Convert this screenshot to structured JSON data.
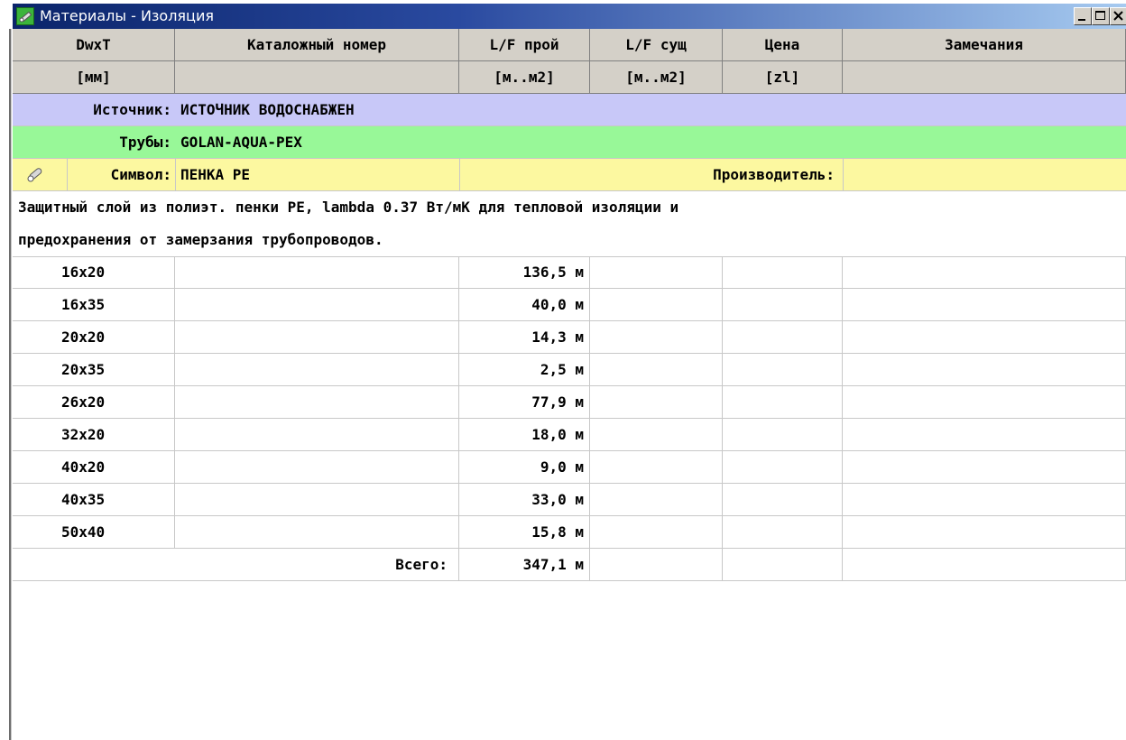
{
  "window": {
    "title": "Материалы - Изоляция",
    "buttons": {
      "minimize": "_",
      "maximize": "□",
      "close": "X"
    }
  },
  "header": {
    "columns": [
      "DwxT",
      "Каталожный номер",
      "L/F прой",
      "L/F сущ",
      "Цена",
      "Замечания"
    ],
    "units": [
      "[мм]",
      "",
      "[м..м2]",
      "[м..м2]",
      "[zl]",
      ""
    ]
  },
  "source": {
    "label": "Источник:",
    "value": "ИСТОЧНИК ВОДОСНАБЖЕН",
    "color": "#c8c8f8"
  },
  "pipes": {
    "label": "Трубы:",
    "value": "GOLAN-AQUA-PEX",
    "color": "#98f898"
  },
  "symbol": {
    "icon": "insulation-tube-icon",
    "label": "Символ:",
    "value": "ПЕНКА PE",
    "manufacturer_label": "Производитель:",
    "manufacturer": "",
    "color": "#fcf8a0"
  },
  "description": [
    "Защитный слой из полиэт. пенки PE, lambda 0.37 Вт/мК для тепловой изоляции и",
    "предохранения от замерзания трубопроводов."
  ],
  "rows": [
    {
      "size": "16x20",
      "catalog": "",
      "lf_planned": "136,5 м",
      "lf_existing": "",
      "price": "",
      "notes": ""
    },
    {
      "size": "16x35",
      "catalog": "",
      "lf_planned": "40,0 м",
      "lf_existing": "",
      "price": "",
      "notes": ""
    },
    {
      "size": "20x20",
      "catalog": "",
      "lf_planned": "14,3 м",
      "lf_existing": "",
      "price": "",
      "notes": ""
    },
    {
      "size": "20x35",
      "catalog": "",
      "lf_planned": "2,5 м",
      "lf_existing": "",
      "price": "",
      "notes": ""
    },
    {
      "size": "26x20",
      "catalog": "",
      "lf_planned": "77,9 м",
      "lf_existing": "",
      "price": "",
      "notes": ""
    },
    {
      "size": "32x20",
      "catalog": "",
      "lf_planned": "18,0 м",
      "lf_existing": "",
      "price": "",
      "notes": ""
    },
    {
      "size": "40x20",
      "catalog": "",
      "lf_planned": "9,0 м",
      "lf_existing": "",
      "price": "",
      "notes": ""
    },
    {
      "size": "40x35",
      "catalog": "",
      "lf_planned": "33,0 м",
      "lf_existing": "",
      "price": "",
      "notes": ""
    },
    {
      "size": "50x40",
      "catalog": "",
      "lf_planned": "15,8 м",
      "lf_existing": "",
      "price": "",
      "notes": ""
    }
  ],
  "total": {
    "label": "Всего:",
    "value": "347,1 м"
  }
}
